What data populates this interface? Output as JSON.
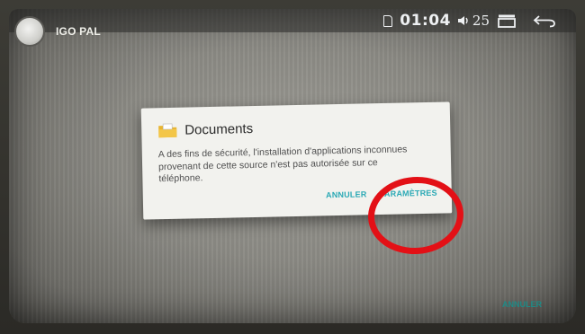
{
  "status_bar": {
    "time": "01:04",
    "volume_level": "25",
    "sim_icon": "sim-card-icon",
    "volume_icon": "volume-icon",
    "recents_icon": "recent-apps-icon",
    "back_icon": "back-arrow-icon"
  },
  "app": {
    "title": "IGO PAL",
    "avatar_icon": "app-avatar-icon"
  },
  "dialog": {
    "icon": "folder-icon",
    "title": "Documents",
    "message": "A des fins de sécurité, l'installation d'applications inconnues provenant de cette source n'est pas autorisée sur ce téléphone.",
    "cancel_label": "ANNULER",
    "settings_label": "PARAMÈTRES",
    "accent_color": "#2aa9b5"
  },
  "screen": {
    "bottom_cancel_label": "ANNULER"
  },
  "annotation": {
    "type": "red-circle-highlight",
    "color": "#e31016",
    "target": "PARAMÈTRES"
  }
}
